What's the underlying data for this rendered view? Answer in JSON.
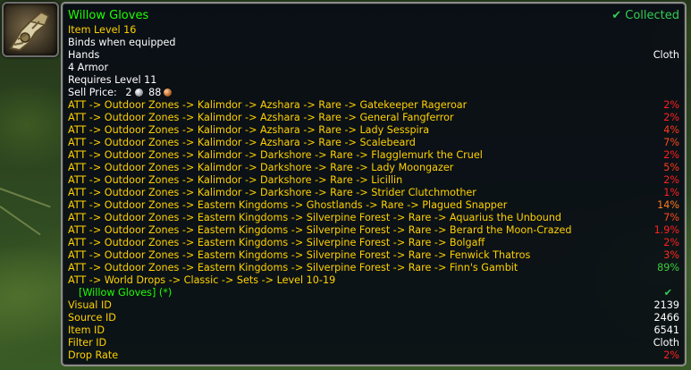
{
  "item": {
    "name": "Willow Gloves",
    "collected_label": "Collected",
    "item_level": "Item Level 16",
    "binds": "Binds when equipped",
    "slot": "Hands",
    "armor_type": "Cloth",
    "armor": "4 Armor",
    "requires": "Requires Level 11",
    "sell_price_label": "Sell Price:",
    "sell_silver": "2",
    "sell_copper": "88"
  },
  "sources": [
    {
      "path": "ATT -> Outdoor Zones -> Kalimdor -> Azshara -> Rare -> Gatekeeper Rageroar",
      "pct": "2%",
      "color": "#ff2020"
    },
    {
      "path": "ATT -> Outdoor Zones -> Kalimdor -> Azshara -> Rare -> General Fangferror",
      "pct": "2%",
      "color": "#ff2020"
    },
    {
      "path": "ATT -> Outdoor Zones -> Kalimdor -> Azshara -> Rare -> Lady Sesspira",
      "pct": "4%",
      "color": "#ff3a1a"
    },
    {
      "path": "ATT -> Outdoor Zones -> Kalimdor -> Azshara -> Rare -> Scalebeard",
      "pct": "7%",
      "color": "#ff4a1a"
    },
    {
      "path": "ATT -> Outdoor Zones -> Kalimdor -> Darkshore -> Rare -> Flagglemurk the Cruel",
      "pct": "2%",
      "color": "#ff2020"
    },
    {
      "path": "ATT -> Outdoor Zones -> Kalimdor -> Darkshore -> Rare -> Lady Moongazer",
      "pct": "5%",
      "color": "#ff3a1a"
    },
    {
      "path": "ATT -> Outdoor Zones -> Kalimdor -> Darkshore -> Rare -> Licillin",
      "pct": "2%",
      "color": "#ff2020"
    },
    {
      "path": "ATT -> Outdoor Zones -> Kalimdor -> Darkshore -> Rare -> Strider Clutchmother",
      "pct": "1%",
      "color": "#ff2020"
    },
    {
      "path": "ATT -> Outdoor Zones -> Eastern Kingdoms -> Ghostlands -> Rare -> Plagued Snapper",
      "pct": "14%",
      "color": "#ff7a20"
    },
    {
      "path": "ATT -> Outdoor Zones -> Eastern Kingdoms -> Silverpine Forest -> Rare -> Aquarius the Unbound",
      "pct": "7%",
      "color": "#ff4a1a"
    },
    {
      "path": "ATT -> Outdoor Zones -> Eastern Kingdoms -> Silverpine Forest -> Rare -> Berard the Moon-Crazed",
      "pct": "1.9%",
      "color": "#ff2020"
    },
    {
      "path": "ATT -> Outdoor Zones -> Eastern Kingdoms -> Silverpine Forest -> Rare -> Bolgaff",
      "pct": "2%",
      "color": "#ff2020"
    },
    {
      "path": "ATT -> Outdoor Zones -> Eastern Kingdoms -> Silverpine Forest -> Rare -> Fenwick Thatros",
      "pct": "3%",
      "color": "#ff2a1a"
    },
    {
      "path": "ATT -> Outdoor Zones -> Eastern Kingdoms -> Silverpine Forest -> Rare -> Finn's Gambit",
      "pct": "89%",
      "color": "#3ccf3c"
    },
    {
      "path": "ATT -> World Drops -> Classic -> Sets -> Level 10-19",
      "pct": "",
      "color": "#ff2020"
    }
  ],
  "set_line": {
    "label": "[Willow Gloves] (*)"
  },
  "details": [
    {
      "label": "Visual ID",
      "value": "2139"
    },
    {
      "label": "Source ID",
      "value": "2466"
    },
    {
      "label": "Item ID",
      "value": "6541"
    },
    {
      "label": "Filter ID",
      "value": "Cloth"
    },
    {
      "label": "Drop Rate",
      "value": "2%"
    }
  ],
  "colors": {
    "item_name": "#1eff00",
    "source_path": "#ffd100",
    "detail_label": "#ffd100",
    "drop_rate": "#ff2020",
    "border": "#8c8c8c"
  },
  "icons": {
    "item": "gauntlet-icon",
    "collected": "checkmark-icon",
    "silver": "silver-coin-icon",
    "copper": "copper-coin-icon"
  }
}
